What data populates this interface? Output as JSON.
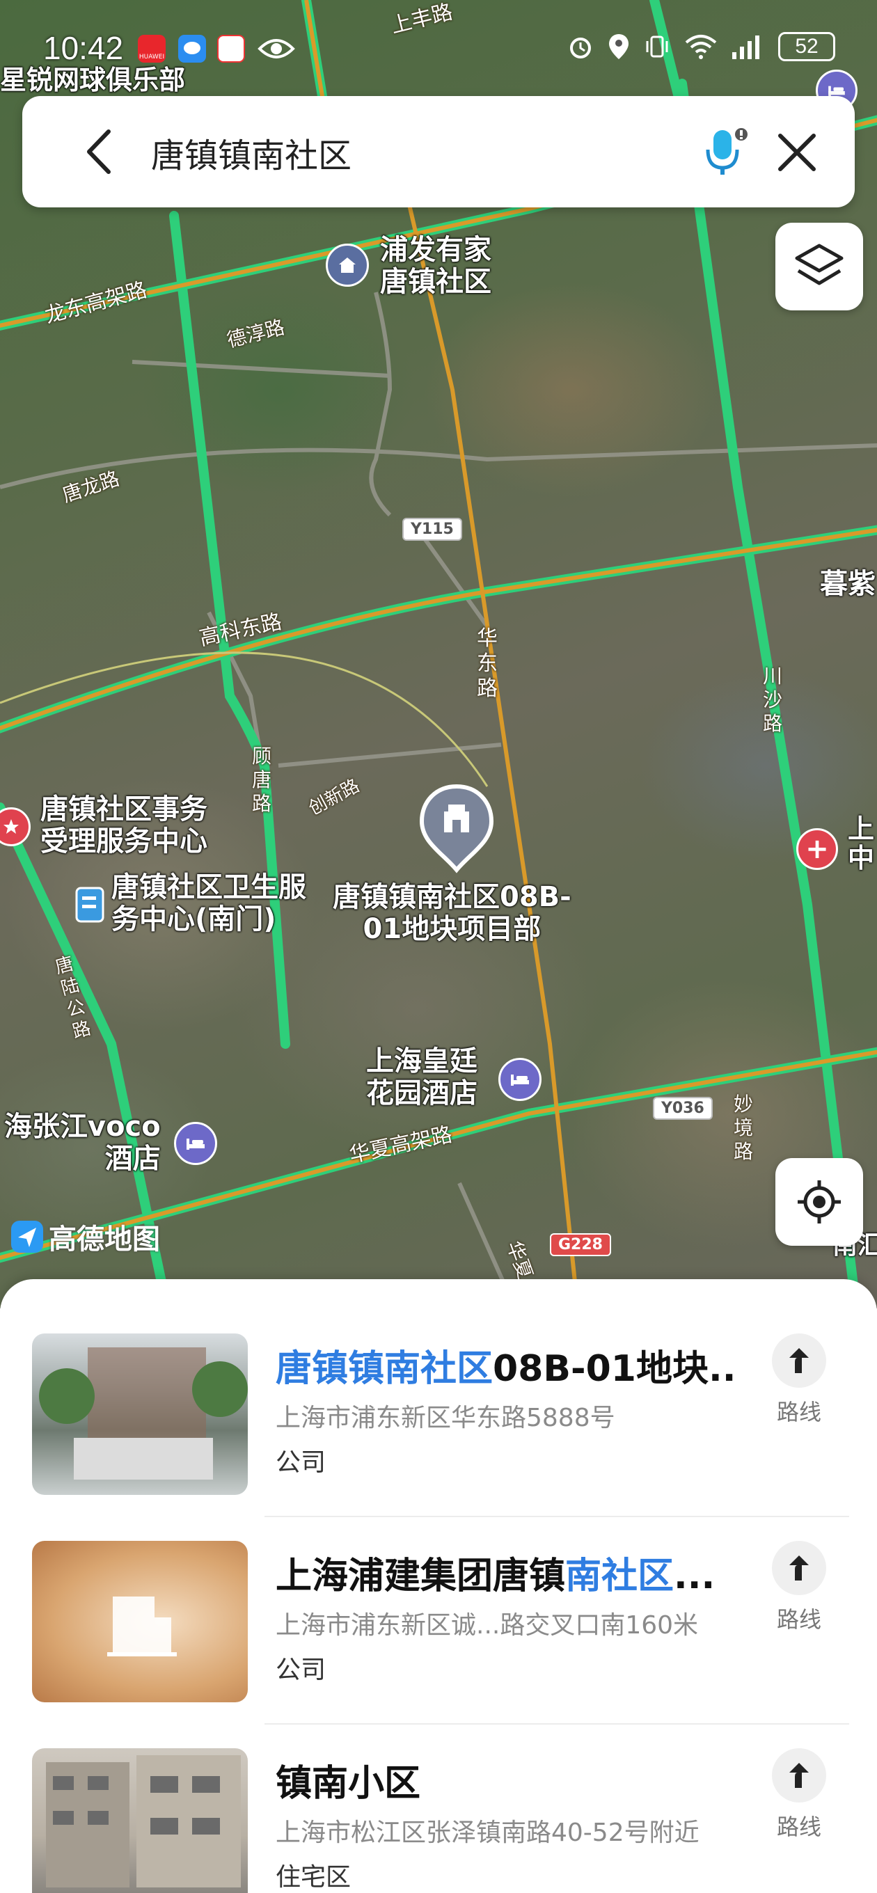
{
  "status_bar": {
    "time": "10:42",
    "battery": "52",
    "app_icons": [
      "HUAWEI",
      "Messages",
      "TikTok Shop"
    ]
  },
  "search": {
    "query": "唐镇镇南社区"
  },
  "map": {
    "top_left_label": "星锐网球俱乐部",
    "labels": {
      "pufa": "浦发有家\n唐镇社区",
      "service_center": "唐镇社区事务\n受理服务中心",
      "health_center": "唐镇社区卫生服\n务中心(南门)",
      "project": "唐镇镇南社区08B-\n01地块项目部",
      "hotel_huangting": "上海皇廷\n花园酒店",
      "hotel_voco": "海张江voco\n酒店",
      "mu_zi": "暮紫",
      "right_edge": "上\n中",
      "right_bottom": "南汇"
    },
    "roads": {
      "shangfeng": "上丰路",
      "longdong": "龙东高架路",
      "dechun": "德淳路",
      "tanglong": "唐龙路",
      "gaoke": "高科东路",
      "huadong": "华\n东\n路",
      "chuansha": "川\n沙\n路",
      "gutang": "顾\n唐\n路",
      "chuangxin": "创新路",
      "tanglu": "唐\n陆\n公\n路",
      "huaxia": "华夏高架路",
      "miaojing": "妙\n境\n路",
      "huaxia2": "华夏"
    },
    "shields": {
      "y115": "Y115",
      "y036": "Y036",
      "g228": "G228"
    },
    "watermark": "高德地图",
    "colors": {
      "road_green": "#2ecf7a",
      "road_orange": "#d99a2a",
      "accent_blue": "#2f7de1"
    }
  },
  "results": [
    {
      "title_highlight": "唐镇镇南社区",
      "title_rest": "08B-01地块...",
      "address": "上海市浦东新区华东路5888号",
      "category": "公司",
      "route_label": "路线"
    },
    {
      "title_prefix": "上海浦建集团唐镇",
      "title_highlight": "南社区",
      "title_rest": "...",
      "address": "上海市浦东新区诚...路交叉口南160米",
      "category": "公司",
      "route_label": "路线"
    },
    {
      "title_rest": "镇南小区",
      "address": "上海市松江区张泽镇南路40-52号附近",
      "category": "住宅区",
      "route_label": "路线"
    }
  ]
}
